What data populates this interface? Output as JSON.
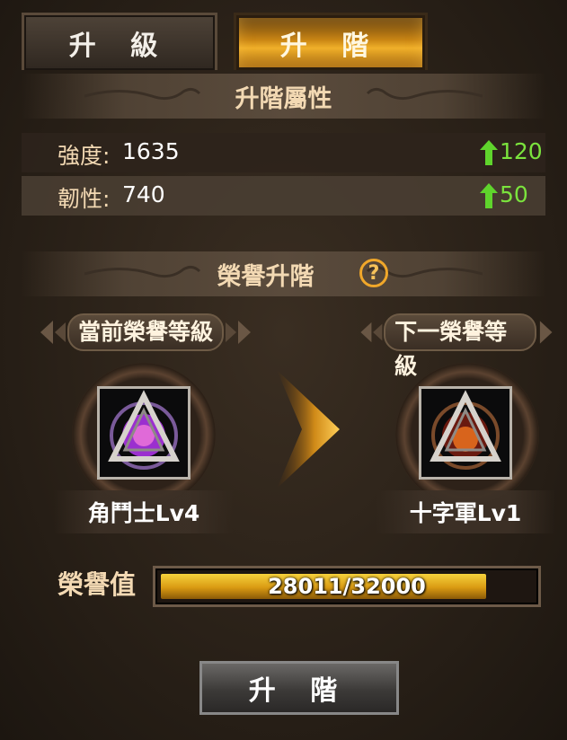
{
  "tabs": {
    "upgrade": "升 級",
    "advance": "升 階"
  },
  "advance_attr": {
    "title": "升階屬性",
    "stats": [
      {
        "label": "強度:",
        "value": "1635",
        "increase": "120"
      },
      {
        "label": "韌性:",
        "value": "740",
        "increase": "50"
      }
    ]
  },
  "honor": {
    "title": "榮譽升階",
    "help": "?",
    "current_label": "當前榮譽等級",
    "next_label": "下一榮譽等級",
    "current_name": "角鬥士Lv4",
    "next_name": "十字軍Lv1",
    "value_label": "榮譽值",
    "progress_text": "28011/32000",
    "progress_fraction": 0.875
  },
  "button": {
    "advance": "升 階"
  },
  "colors": {
    "gold": "#f0b02a",
    "increase_green": "#7be33d",
    "current_emblem": "#9b2fcf",
    "next_emblem": "#d8641c"
  }
}
